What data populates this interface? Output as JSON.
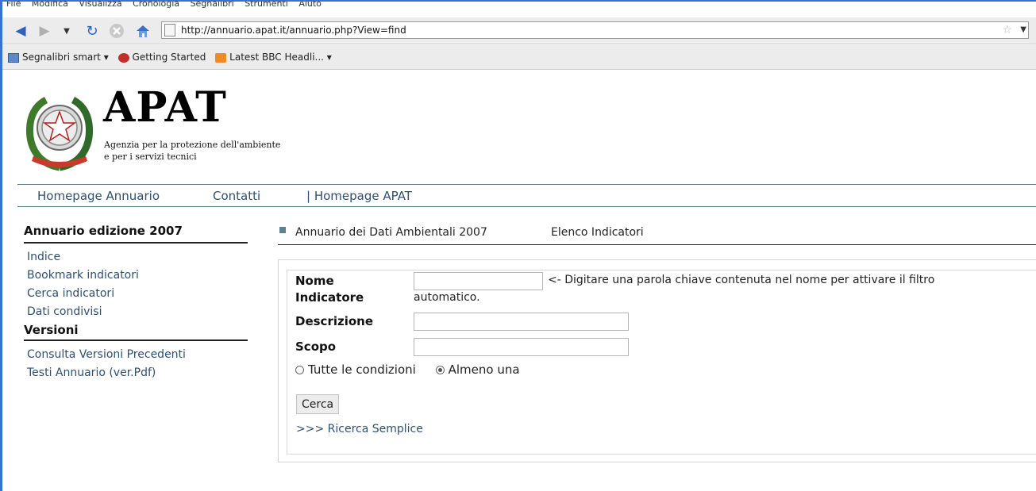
{
  "browser": {
    "menu": [
      "File",
      "Modifica",
      "Visualizza",
      "Cronologia",
      "Segnalibri",
      "Strumenti",
      "Aiuto"
    ],
    "url": "http://annuario.apat.it/annuario.php?View=find",
    "bookmarks": [
      "Segnalibri smart ▾",
      "Getting Started",
      "Latest BBC Headli... ▾"
    ]
  },
  "header": {
    "brand": "APAT",
    "tagline_1": "Agenzia per la protezione dell'ambiente",
    "tagline_2": "e per i servizi tecnici"
  },
  "topnav": {
    "homepage_annuario": "Homepage Annuario",
    "contatti": "Contatti",
    "homepage_apat": "| Homepage APAT"
  },
  "sidebar": {
    "title": "Annuario edizione 2007",
    "links": [
      "Indice",
      "Bookmark indicatori",
      "Cerca indicatori",
      "Dati condivisi"
    ],
    "versions_title": "Versioni",
    "version_links": [
      "Consulta Versioni Precedenti",
      "Testi Annuario (ver.Pdf)"
    ]
  },
  "breadcrumb": {
    "section": "Annuario dei Dati Ambientali 2007",
    "page": "Elenco Indicatori"
  },
  "form": {
    "nome_label_1": "Nome",
    "nome_label_2": "Indicatore",
    "nome_value": "",
    "hint_1": "<-  Digitare una parola chiave contenuta nel nome per attivare il filtro",
    "hint_2": "automatico.",
    "descrizione_label": "Descrizione",
    "descrizione_value": "",
    "scopo_label": "Scopo",
    "scopo_value": "",
    "radio_all": "Tutte le condizioni",
    "radio_any": "Almeno una",
    "submit_label": "Cerca",
    "simple_link": ">>> Ricerca Semplice"
  },
  "colors": {
    "link": "#2f4f6f",
    "chrome_border": "#3a6fd8"
  }
}
